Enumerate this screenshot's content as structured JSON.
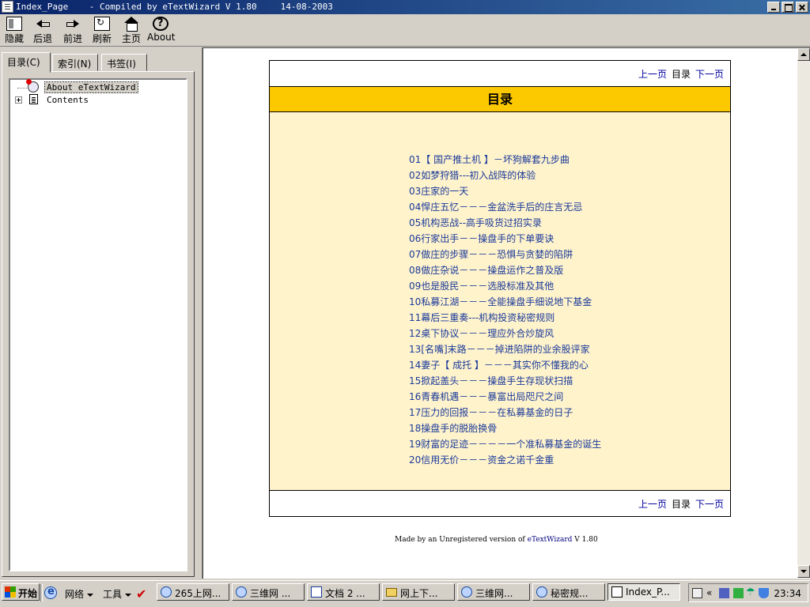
{
  "window": {
    "title": "Index_Page    - Compiled by eTextWizard V 1.80",
    "date": "14-08-2003"
  },
  "toolbar": {
    "hide": "隐藏",
    "back": "后退",
    "forward": "前进",
    "refresh": "刷新",
    "home": "主页",
    "about": "About"
  },
  "tabs": {
    "contents": "目录(C)",
    "index": "索引(N)",
    "bookmarks": "书签(I)"
  },
  "tree": {
    "items": [
      {
        "label": "About eTextWizard",
        "icon": "about-icon"
      },
      {
        "label": "Contents",
        "icon": "document-icon"
      }
    ]
  },
  "page": {
    "nav": {
      "prev": "上一页",
      "toc": "目录",
      "next": "下一页"
    },
    "header": "目录",
    "toc": [
      "01【 国产推土机 】－坏狗解套九步曲",
      "02如梦狩猎---初入战阵的体验",
      "03庄家的一天",
      "04悍庄五忆－－－金盆洗手后的庄言无忌",
      "05机构恶战--高手吸货过招实录",
      "06行家出手－－操盘手的下单要诀",
      "07做庄的步骤－－－恐惧与贪婪的陷阱",
      "08做庄杂说－－－操盘运作之普及版",
      "09也是股民－－－选股标准及其他",
      "10私募江湖－－－全能操盘手细说地下基金",
      "11幕后三重奏---机构投资秘密规则",
      "12桌下协议－－－理应外合炒旋风",
      "13[名嘴]末路－－－掉进陷阱的业余股评家",
      "14妻子【 成托 】－－－其实你不懂我的心",
      "15掀起盖头－－－操盘手生存现状扫描",
      "16青春机遇－－－暴富出局咫尺之间",
      "17压力的回报－－－在私募基金的日子",
      "18操盘手的脱胎换骨",
      "19财富的足迹－－－－一个准私募基金的诞生",
      "20信用无价－－－资金之诺千金重"
    ],
    "footer_prefix": "Made by an Unregistered version of ",
    "footer_link": "eTextWizard",
    "footer_suffix": " V 1.80"
  },
  "taskbar": {
    "start": "开始",
    "network": "网络",
    "tools": "工具",
    "tasks": [
      {
        "label": "265上网...",
        "icon": "ie-icon"
      },
      {
        "label": "三维网 ...",
        "icon": "ie-icon"
      },
      {
        "label": "文档 2 ...",
        "icon": "word-icon"
      },
      {
        "label": "网上下...",
        "icon": "folder-icon"
      },
      {
        "label": "三维网...",
        "icon": "ie-icon"
      },
      {
        "label": "秘密规...",
        "icon": "ie-icon"
      },
      {
        "label": "Index_P...",
        "icon": "help-icon"
      }
    ],
    "tray_arrows": "«",
    "clock": "23:34"
  },
  "colors": {
    "header_band": "#fcc800",
    "body_band": "#fff3cc",
    "link": "#1a3a9a",
    "titlebar": "#0a246a"
  }
}
